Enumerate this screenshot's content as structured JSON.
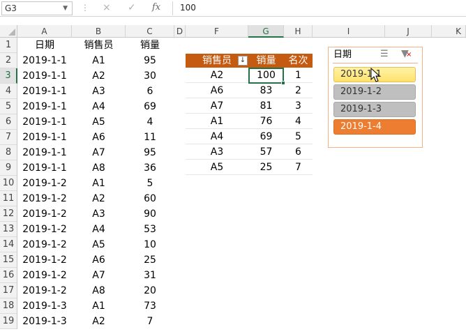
{
  "formula_bar": {
    "name_box": "G3",
    "cancel_icon": "×",
    "enter_icon": "✓",
    "fx_label": "fx",
    "value": "100"
  },
  "columns": [
    "A",
    "B",
    "C",
    "D",
    "F",
    "G",
    "H",
    "I",
    "J",
    "K"
  ],
  "row_numbers": [
    "1",
    "2",
    "3",
    "4",
    "5",
    "6",
    "7",
    "8",
    "9",
    "10",
    "11",
    "12",
    "13",
    "14",
    "15",
    "16",
    "17",
    "18",
    "19"
  ],
  "source_table": {
    "headers": [
      "日期",
      "销售员",
      "销量"
    ],
    "rows": [
      [
        "2019-1-1",
        "A1",
        "95"
      ],
      [
        "2019-1-1",
        "A2",
        "30"
      ],
      [
        "2019-1-1",
        "A3",
        "6"
      ],
      [
        "2019-1-1",
        "A4",
        "69"
      ],
      [
        "2019-1-1",
        "A5",
        "4"
      ],
      [
        "2019-1-1",
        "A6",
        "11"
      ],
      [
        "2019-1-1",
        "A7",
        "95"
      ],
      [
        "2019-1-1",
        "A8",
        "36"
      ],
      [
        "2019-1-2",
        "A1",
        "5"
      ],
      [
        "2019-1-2",
        "A2",
        "60"
      ],
      [
        "2019-1-2",
        "A3",
        "90"
      ],
      [
        "2019-1-2",
        "A4",
        "53"
      ],
      [
        "2019-1-2",
        "A5",
        "10"
      ],
      [
        "2019-1-2",
        "A6",
        "25"
      ],
      [
        "2019-1-2",
        "A7",
        "31"
      ],
      [
        "2019-1-2",
        "A8",
        "20"
      ],
      [
        "2019-1-3",
        "A1",
        "73"
      ],
      [
        "2019-1-3",
        "A2",
        "7"
      ]
    ]
  },
  "pivot_table": {
    "headers": [
      "销售员",
      "销量",
      "名次"
    ],
    "sort_icon": "↓",
    "rows": [
      [
        "A2",
        "100",
        "1"
      ],
      [
        "A6",
        "83",
        "2"
      ],
      [
        "A7",
        "81",
        "3"
      ],
      [
        "A1",
        "76",
        "4"
      ],
      [
        "A4",
        "69",
        "5"
      ],
      [
        "A3",
        "57",
        "6"
      ],
      [
        "A5",
        "25",
        "7"
      ]
    ]
  },
  "slicer": {
    "title": "日期",
    "multi_select_icon": "multi-select-icon",
    "clear_filter_icon": "clear-filter-icon",
    "items": [
      "2019-1-1",
      "2019-1-2",
      "2019-1-3",
      "2019-1-4"
    ],
    "colors": {
      "hover": "#fee26b",
      "selected": "#ed7d31",
      "dim": "#bfbfbf"
    }
  },
  "accent": {
    "excel_green": "#217346",
    "pivot_header": "#c55a11"
  }
}
